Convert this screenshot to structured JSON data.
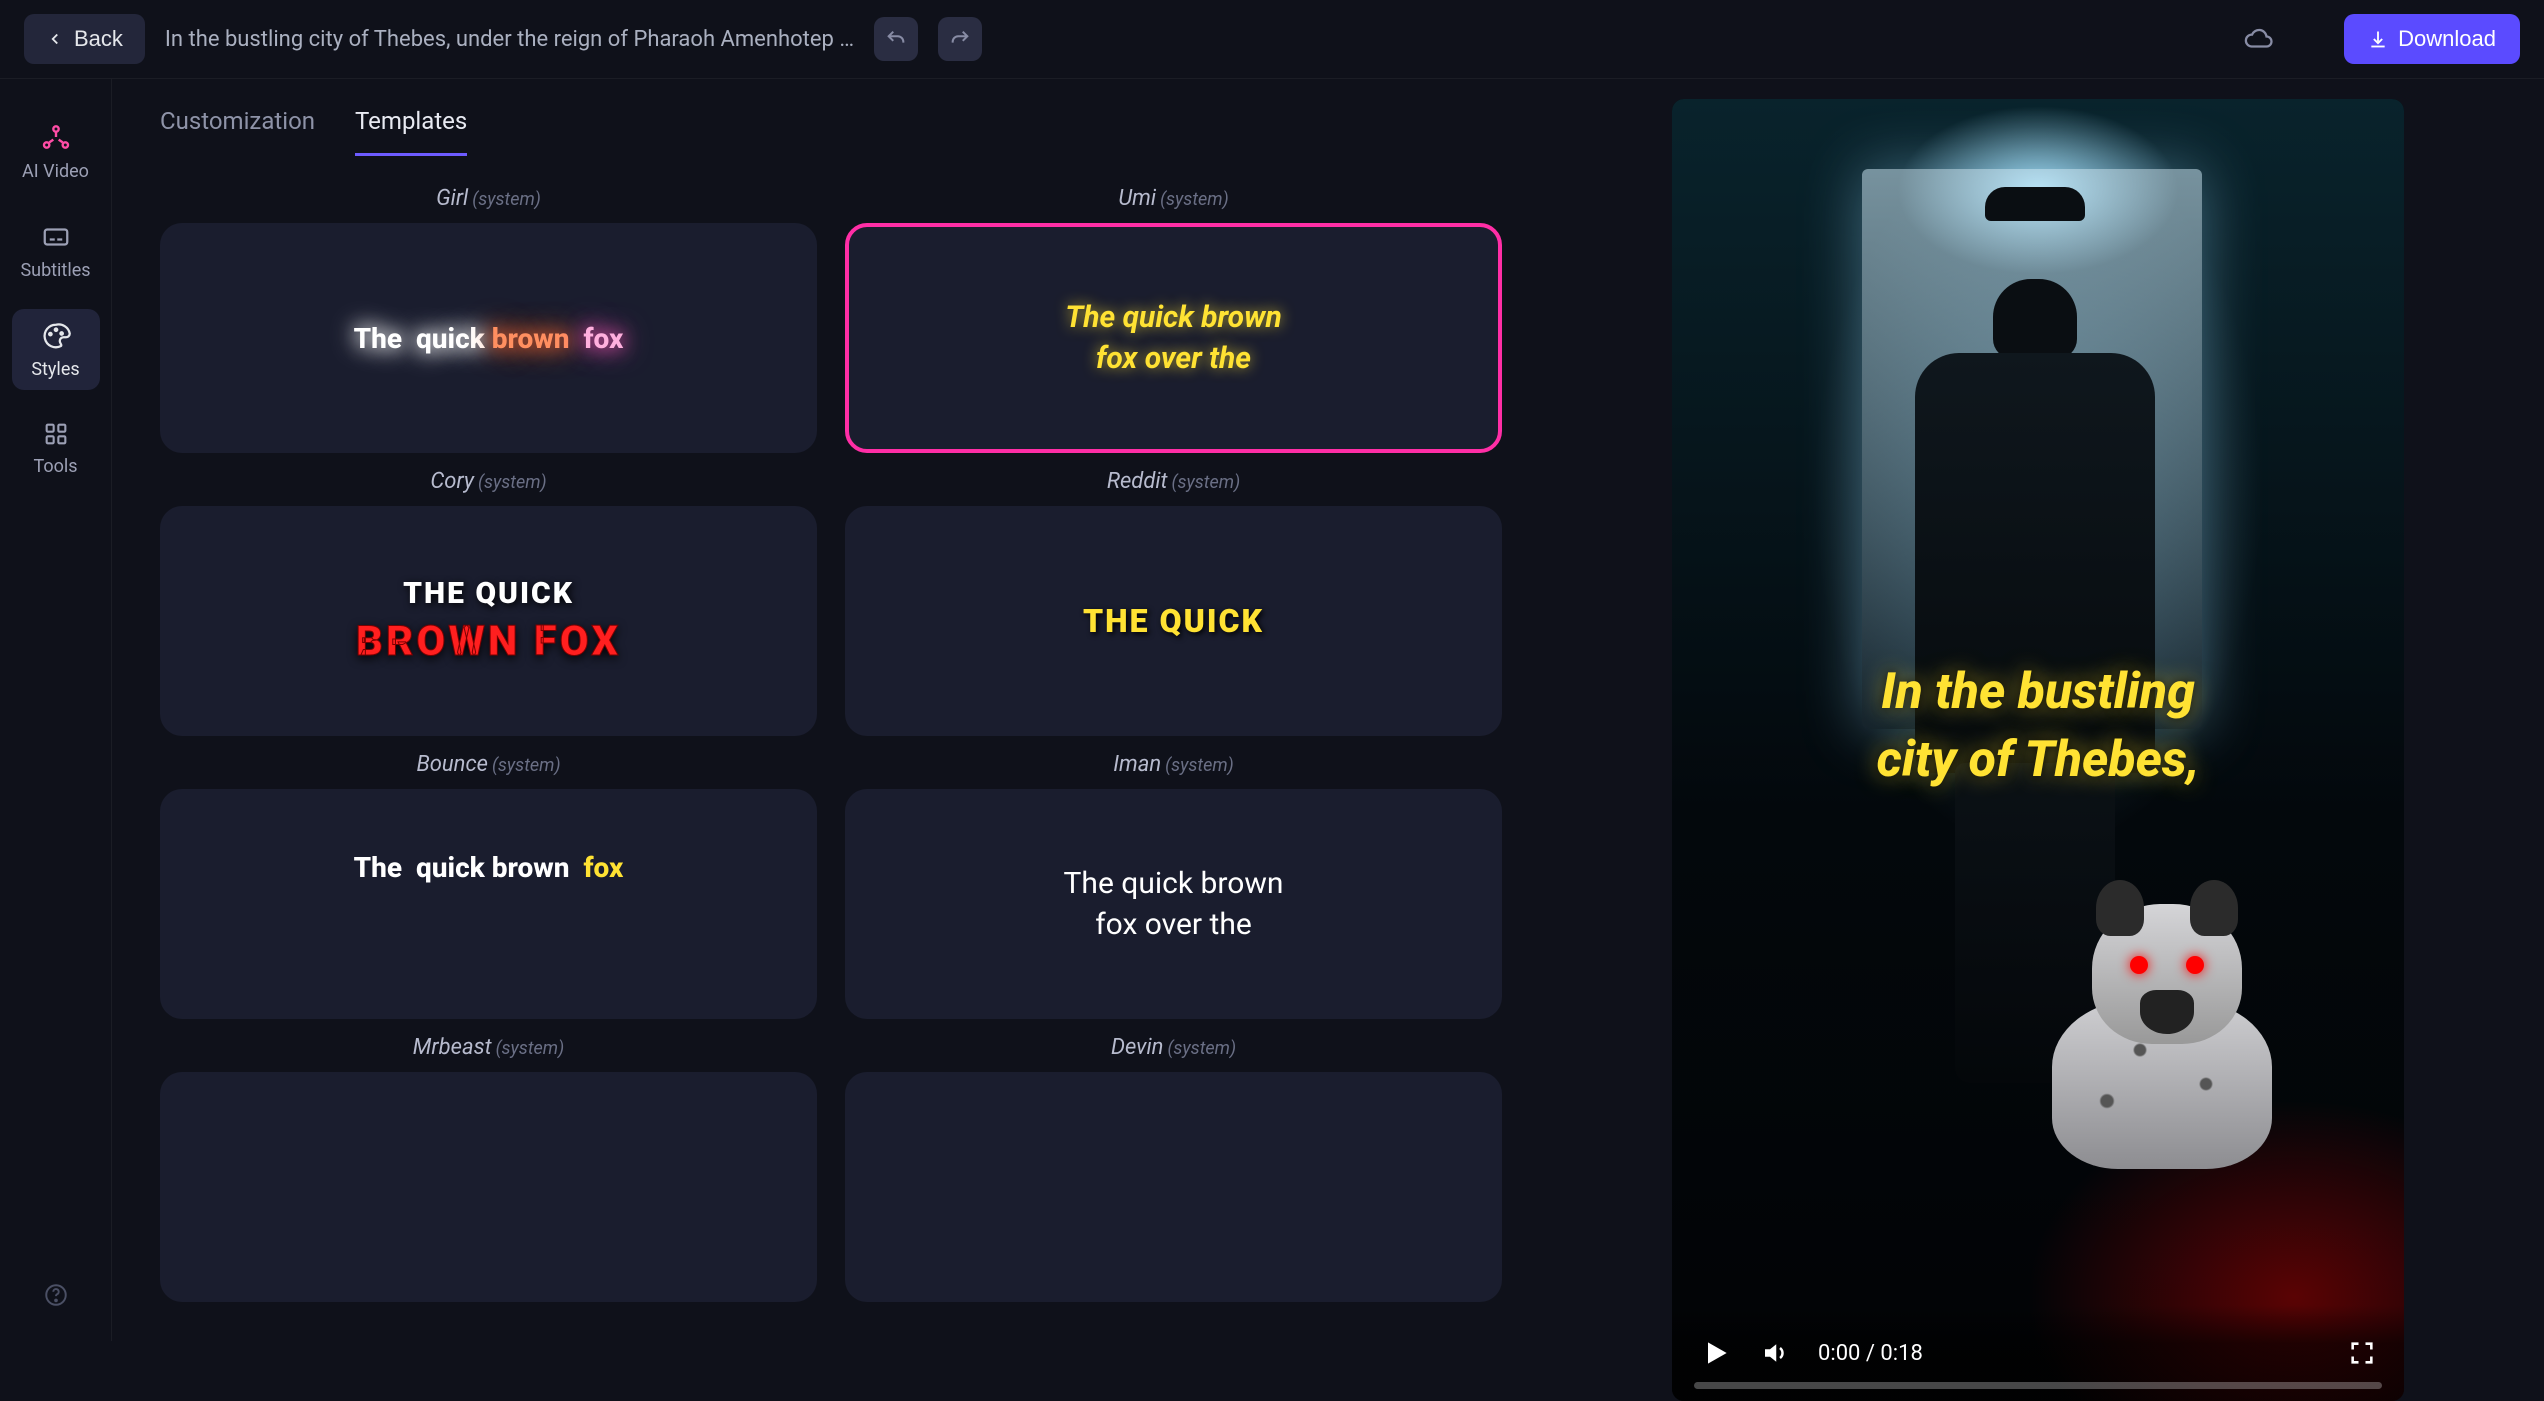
{
  "header": {
    "back_label": "Back",
    "title": "In the bustling city of Thebes, under the reign of Pharaoh Amenhotep …",
    "download_label": "Download"
  },
  "sidebar": {
    "items": [
      {
        "label": "AI Video"
      },
      {
        "label": "Subtitles"
      },
      {
        "label": "Styles"
      },
      {
        "label": "Tools"
      }
    ]
  },
  "tabs": {
    "customization": "Customization",
    "templates": "Templates",
    "active": "templates"
  },
  "system_tag": "(system)",
  "templates": [
    {
      "name": "Girl",
      "selected": false,
      "preview_line1": "The  quick brown  fox"
    },
    {
      "name": "Umi",
      "selected": true,
      "preview_line1": "The  quick brown",
      "preview_line2": "fox  over  the"
    },
    {
      "name": "Cory",
      "selected": false,
      "preview_line1": "THE  QUICK",
      "preview_line2": "BROWN  FOX"
    },
    {
      "name": "Reddit",
      "selected": false,
      "preview_line1": "THE  QUICK"
    },
    {
      "name": "Bounce",
      "selected": false,
      "preview_line1": "The  quick brown  fox"
    },
    {
      "name": "Iman",
      "selected": false,
      "preview_line1": "The  quick brown",
      "preview_line2": "fox  over  the"
    },
    {
      "name": "Mrbeast",
      "selected": false
    },
    {
      "name": "Devin",
      "selected": false
    }
  ],
  "preview": {
    "overlay_line1": "In the bustling",
    "overlay_line2": "city of Thebes,",
    "time_current": "0:00",
    "time_total": "0:18"
  }
}
